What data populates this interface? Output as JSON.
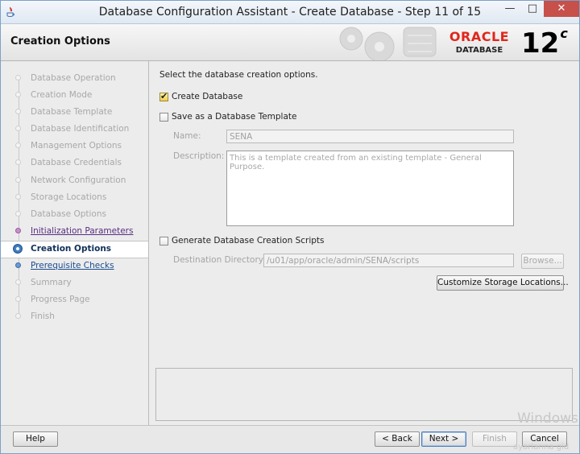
{
  "window": {
    "title": "Database Configuration Assistant - Create Database - Step 11 of 15",
    "min_glyph": "—",
    "max_glyph": "□",
    "close_glyph": "✕"
  },
  "header": {
    "page_title": "Creation Options",
    "brand": "ORACLE",
    "brand_sub": "DATABASE",
    "version": "12",
    "version_suffix": "c",
    "brand_color": "#e0261b"
  },
  "sidebar": {
    "steps": [
      {
        "label": "Database Operation",
        "state": "done"
      },
      {
        "label": "Creation Mode",
        "state": "done"
      },
      {
        "label": "Database Template",
        "state": "done"
      },
      {
        "label": "Database Identification",
        "state": "done"
      },
      {
        "label": "Management Options",
        "state": "done"
      },
      {
        "label": "Database Credentials",
        "state": "done"
      },
      {
        "label": "Network Configuration",
        "state": "done"
      },
      {
        "label": "Storage Locations",
        "state": "done"
      },
      {
        "label": "Database Options",
        "state": "done"
      },
      {
        "label": "Initialization Parameters",
        "state": "visited"
      },
      {
        "label": "Creation Options",
        "state": "current"
      },
      {
        "label": "Prerequisite Checks",
        "state": "link"
      },
      {
        "label": "Summary",
        "state": "pending"
      },
      {
        "label": "Progress Page",
        "state": "pending"
      },
      {
        "label": "Finish",
        "state": "pending"
      }
    ]
  },
  "main": {
    "intro": "Select the database creation options.",
    "create_database": {
      "label": "Create Database",
      "checked": true
    },
    "save_template": {
      "label": "Save as a Database Template",
      "checked": false
    },
    "name_label": "Name:",
    "name_value": "SENA",
    "description_label": "Description:",
    "description_value": "This is a template created from an existing template - General Purpose.",
    "generate_scripts": {
      "label": "Generate Database Creation Scripts",
      "checked": false
    },
    "destination_label": "Destination Directory:",
    "destination_value": "/u01/app/oracle/admin/SENA/scripts",
    "browse_label": "Browse...",
    "customize_label": "Customize Storage Locations..."
  },
  "footer": {
    "help": "Help",
    "back": "< Back",
    "next": "Next >",
    "finish": "Finish",
    "cancel": "Cancel"
  },
  "overlay": {
    "watermark": "Windows'",
    "watermark_sub": "ayarlarına gid"
  }
}
